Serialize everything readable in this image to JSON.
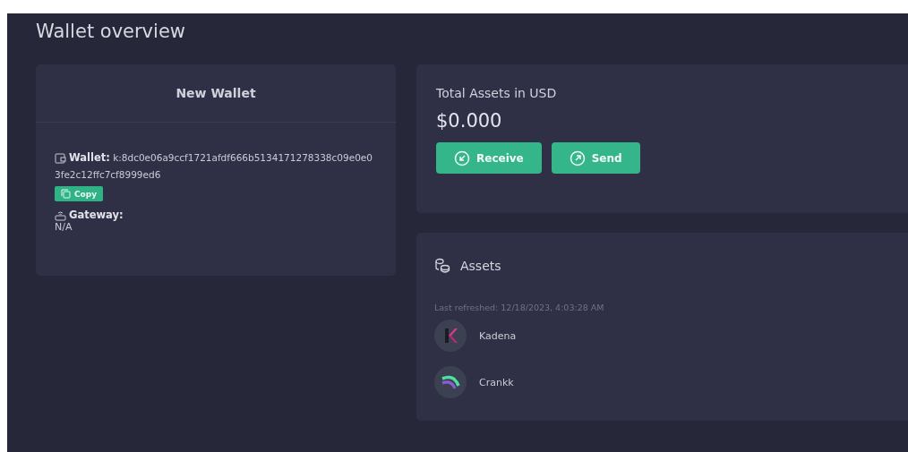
{
  "page": {
    "title": "Wallet overview"
  },
  "wallet_card": {
    "title": "New Wallet",
    "wallet_label": "Wallet:",
    "address": "k:8dc0e06a9ccf1721afdf666b5134171278338c09e0e03fe2c12ffc7cf8999ed6",
    "copy_button": "Copy",
    "gateway_label": "Gateway:",
    "gateway_value": "N/A"
  },
  "total_card": {
    "title": "Total Assets in USD",
    "amount": "$0.000",
    "buttons": [
      {
        "kind": "receive",
        "label": "Receive"
      },
      {
        "kind": "send",
        "label": "Send"
      }
    ]
  },
  "assets_card": {
    "title": "Assets",
    "refreshed": "Last refreshed: 12/18/2023, 4:03:28 AM",
    "assets": [
      {
        "kind": "k-mark",
        "name": "Kadena"
      },
      {
        "kind": "arcs",
        "name": "Crankk"
      }
    ]
  }
}
